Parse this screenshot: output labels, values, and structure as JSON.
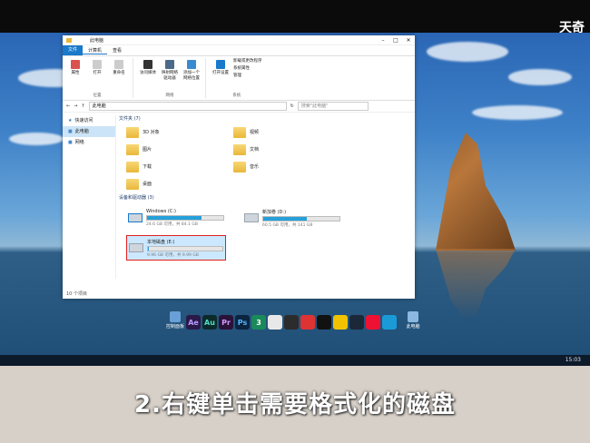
{
  "brand": "天奇",
  "subtitle": "2.右键单击需要格式化的磁盘",
  "clock": "15:03",
  "desktop_icons": [
    {
      "label": "控制面板"
    },
    {
      "label": "此电脑"
    }
  ],
  "dock_apps": [
    "Ae",
    "Au",
    "Pr",
    "Ps",
    "3",
    "",
    "",
    "",
    "",
    "",
    "",
    "",
    ""
  ],
  "window": {
    "title": "此电脑",
    "tabs": [
      "文件",
      "计算机",
      "查看"
    ],
    "ribbon": {
      "group1": {
        "buttons": [
          "属性",
          "打开",
          "重命名"
        ],
        "label": "位置"
      },
      "group2": {
        "buttons": [
          "访问媒体",
          "映射网络驱动器",
          "添加一个网络位置"
        ],
        "label": "网络"
      },
      "group3": {
        "buttons": [
          "打开设置"
        ],
        "small": [
          "卸载或更改程序",
          "系统属性",
          "管理"
        ],
        "label": "系统"
      }
    },
    "address": {
      "path": "此电脑",
      "search_placeholder": "搜索\"此电脑\""
    },
    "nav": [
      "快速访问",
      "此电脑",
      "网络"
    ],
    "folders_section": "文件夹 (7)",
    "folders": [
      "3D 对象",
      "视频",
      "图片",
      "文档",
      "下载",
      "音乐",
      "桌面"
    ],
    "drives_section": "设备和驱动器 (3)",
    "drives": [
      {
        "name": "Windows (C:)",
        "free": "24.6 GB 可用，共 84.1 GB",
        "used_fraction": 0.71
      },
      {
        "name": "新加卷 (D:)",
        "free": "60.5 GB 可用，共 141 GB",
        "used_fraction": 0.57
      },
      {
        "name": "本地磁盘 (E:)",
        "free": "9.96 GB 可用，共 9.99 GB",
        "used_fraction": 0.01
      }
    ],
    "status": "10 个项目"
  },
  "colors": {
    "accent": "#1979ca",
    "highlight_border": "#e02020"
  }
}
